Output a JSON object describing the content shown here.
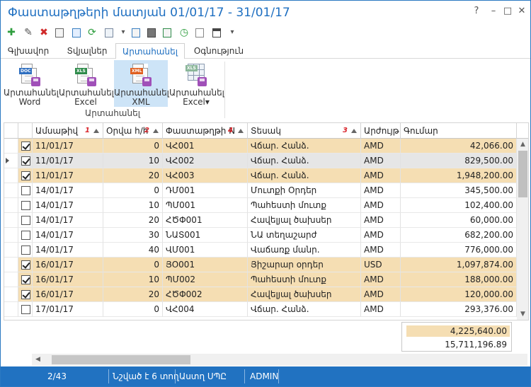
{
  "window": {
    "title": "Փաստաթղթերի մատյան 01/01/17 - 31/01/17"
  },
  "window_controls": {
    "help": "?",
    "minimize": "–",
    "maximize": "□",
    "close": "✕"
  },
  "quick_toolbar": {
    "icons": [
      "add-icon",
      "edit-icon",
      "delete-icon",
      "copy-icon",
      "export-icon",
      "refresh-icon",
      "xls-icon",
      "dropdown-icon",
      "preview-icon",
      "print-icon",
      "xls-export-icon",
      "history-icon",
      "layout-icon",
      "settings-icon",
      "more-icon"
    ],
    "glyphs": {
      "add": "✚",
      "delete": "✖",
      "refresh": "⟳",
      "history": "◷",
      "dropdown": "▾",
      "more": "▾",
      "edit": "✎"
    }
  },
  "ribbon_tabs": [
    "Գլխավոր",
    "Տվյալներ",
    "Արտահանել",
    "Օգնություն"
  ],
  "active_tab": 2,
  "ribbon": {
    "buttons": [
      {
        "line1": "Արտահանել",
        "line2": "Word",
        "tag": "DOC",
        "tag_color": "#2f6fc0"
      },
      {
        "line1": "Արտահանել",
        "line2": "Excel",
        "tag": "XLS",
        "tag_color": "#2e8b4a"
      },
      {
        "line1": "Արտահանել",
        "line2": "XML",
        "tag": "XML",
        "tag_color": "#e06020"
      },
      {
        "line1": "Արտահանել",
        "line2": "Excel▾",
        "tag": "",
        "tag_color": "#8b9bb0"
      }
    ],
    "selected": 2,
    "group_label": "Արտահանել"
  },
  "grid": {
    "columns": [
      {
        "label": "Ամսաթիվ",
        "sort": "1"
      },
      {
        "label": "Օրվա հ/հ",
        "sort": "2"
      },
      {
        "label": "Փաստաթղթի N",
        "sort": "4"
      },
      {
        "label": "Տեսակ",
        "sort": "3"
      },
      {
        "label": "Արժույթ",
        "sort": ""
      },
      {
        "label": "Գումար",
        "sort": ""
      }
    ],
    "rows": [
      {
        "checked": true,
        "current": false,
        "date": "11/01/17",
        "day_no": "0",
        "doc_no": "ՎՀ001",
        "type": "Վճար. Հանձ.",
        "currency": "AMD",
        "amount": "42,066.00",
        "style": "tan"
      },
      {
        "checked": true,
        "current": true,
        "date": "11/01/17",
        "day_no": "10",
        "doc_no": "ՎՀ002",
        "type": "Վճար. Հանձ.",
        "currency": "AMD",
        "amount": "829,500.00",
        "style": "gray"
      },
      {
        "checked": true,
        "current": false,
        "date": "11/01/17",
        "day_no": "20",
        "doc_no": "ՎՀ003",
        "type": "Վճար. Հանձ.",
        "currency": "AMD",
        "amount": "1,948,200.00",
        "style": "tan"
      },
      {
        "checked": false,
        "current": false,
        "date": "14/01/17",
        "day_no": "0",
        "doc_no": "ԴՄ001",
        "type": "Մուտքի Օրդեր",
        "currency": "AMD",
        "amount": "345,500.00",
        "style": ""
      },
      {
        "checked": false,
        "current": false,
        "date": "14/01/17",
        "day_no": "10",
        "doc_no": "ՊՄ001",
        "type": "Պահեստի մուտք",
        "currency": "AMD",
        "amount": "102,400.00",
        "style": ""
      },
      {
        "checked": false,
        "current": false,
        "date": "14/01/17",
        "day_no": "20",
        "doc_no": "ՀԾՓ001",
        "type": "Հավելյալ ծախսեր",
        "currency": "AMD",
        "amount": "60,000.00",
        "style": ""
      },
      {
        "checked": false,
        "current": false,
        "date": "14/01/17",
        "day_no": "30",
        "doc_no": "ՆԱՏ001",
        "type": "ՆԱ տեղաշարժ",
        "currency": "AMD",
        "amount": "682,200.00",
        "style": ""
      },
      {
        "checked": false,
        "current": false,
        "date": "14/01/17",
        "day_no": "40",
        "doc_no": "ՎՄ001",
        "type": "Վաճառք մանր.",
        "currency": "AMD",
        "amount": "776,000.00",
        "style": ""
      },
      {
        "checked": true,
        "current": false,
        "date": "16/01/17",
        "day_no": "0",
        "doc_no": "ՅՕ001",
        "type": "Յիշարար օրդեր",
        "currency": "USD",
        "amount": "1,097,874.00",
        "style": "tan"
      },
      {
        "checked": true,
        "current": false,
        "date": "16/01/17",
        "day_no": "10",
        "doc_no": "ՊՄ002",
        "type": "Պահեստի մուտք",
        "currency": "AMD",
        "amount": "188,000.00",
        "style": "tan"
      },
      {
        "checked": true,
        "current": false,
        "date": "16/01/17",
        "day_no": "20",
        "doc_no": "ՀԾՓ002",
        "type": "Հավելյալ ծախսեր",
        "currency": "AMD",
        "amount": "120,000.00",
        "style": "tan"
      },
      {
        "checked": false,
        "current": false,
        "date": "17/01/17",
        "day_no": "0",
        "doc_no": "ՎՀ004",
        "type": "Վճար. Հանձ.",
        "currency": "AMD",
        "amount": "293,376.00",
        "style": ""
      }
    ]
  },
  "totals": {
    "selected": "4,225,640.00",
    "all": "15,711,196.89",
    "selected_color": "#f5deb3"
  },
  "status_bar": {
    "position": "2/43",
    "selected": "Նշված է 6 տող",
    "company": "Աստղ ՍՊԸ",
    "user": "ADMIN"
  },
  "colors": {
    "accent": "#2172c1",
    "selected_row": "#f5deb3",
    "current_row": "#e6e6e6",
    "sort_number": "#d9262c"
  }
}
